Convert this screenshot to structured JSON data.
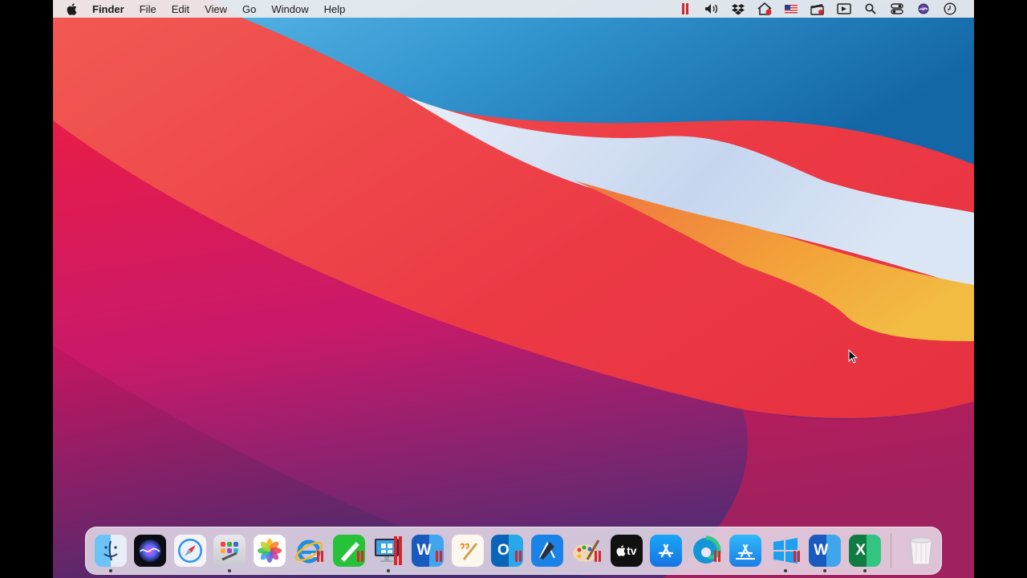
{
  "menubar": {
    "app_name": "Finder",
    "menus": [
      "File",
      "Edit",
      "View",
      "Go",
      "Window",
      "Help"
    ],
    "status_icons": [
      "parallels-icon",
      "volume-icon",
      "dropbox-icon",
      "home-icon",
      "us-flag-icon",
      "clapper-icon",
      "screen-record-icon",
      "spotlight-search-icon",
      "control-center-icon",
      "siri-icon",
      "clock-icon"
    ]
  },
  "dock": {
    "apps": [
      {
        "name": "Finder",
        "icon": "finder-icon",
        "running": true
      },
      {
        "name": "Siri",
        "icon": "siri-icon",
        "running": false
      },
      {
        "name": "Safari",
        "icon": "safari-icon",
        "running": false
      },
      {
        "name": "Launchpad",
        "icon": "launchpad-icon",
        "running": true
      },
      {
        "name": "Photos",
        "icon": "photos-icon",
        "running": false
      },
      {
        "name": "Internet Explorer",
        "icon": "internet-explorer-icon",
        "running": false
      },
      {
        "name": "Parallels App",
        "icon": "green-parallels-app-icon",
        "running": false
      },
      {
        "name": "Windows PC",
        "icon": "windows-pc-icon",
        "running": true
      },
      {
        "name": "Word (Parallels)",
        "icon": "word-parallels-icon",
        "running": false
      },
      {
        "name": "Pages",
        "icon": "pages-icon",
        "running": false
      },
      {
        "name": "Outlook",
        "icon": "outlook-icon",
        "running": false
      },
      {
        "name": "Xcode",
        "icon": "xcode-icon",
        "running": false
      },
      {
        "name": "Paint",
        "icon": "paint-icon",
        "running": false
      },
      {
        "name": "Apple TV",
        "icon": "apple-tv-icon",
        "running": false,
        "label": "tv"
      },
      {
        "name": "App Store",
        "icon": "app-store-icon",
        "running": false
      },
      {
        "name": "Edge",
        "icon": "edge-icon",
        "running": false
      },
      {
        "name": "App Store (Parallels)",
        "icon": "app-store-parallels-icon",
        "running": false
      },
      {
        "name": "Windows",
        "icon": "windows-icon",
        "running": true
      },
      {
        "name": "Word",
        "icon": "word-icon",
        "running": true,
        "label": "W"
      },
      {
        "name": "Excel",
        "icon": "excel-icon",
        "running": true,
        "label": "X"
      }
    ],
    "trash": {
      "name": "Trash",
      "icon": "trash-icon"
    }
  },
  "colors": {
    "parallels_red": "#d7262d",
    "menubar_bg": "#ececee"
  }
}
